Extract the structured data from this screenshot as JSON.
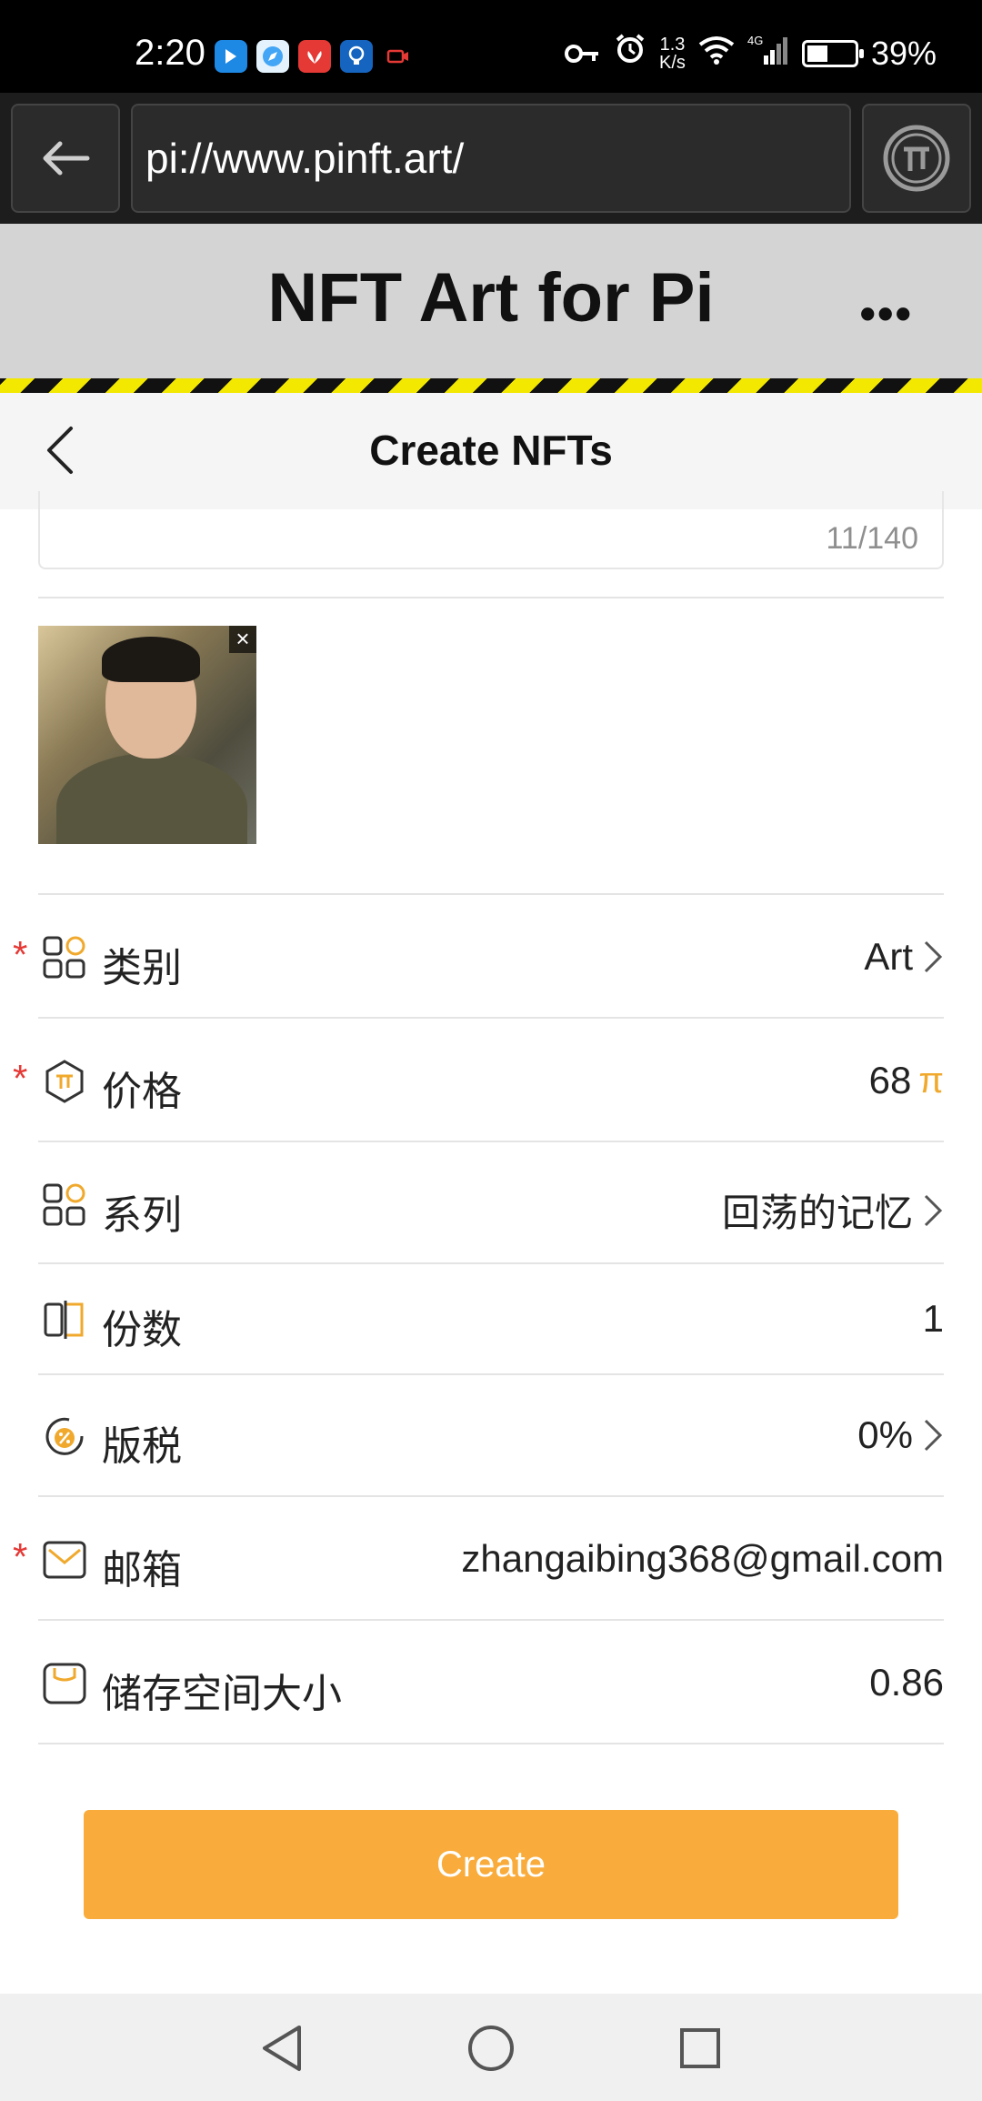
{
  "status_bar": {
    "time": "2:20",
    "net_speed": "1.3\nK/s",
    "network": "4G",
    "battery": "39%",
    "app_icons": [
      "bluetooth-app-icon",
      "safari-app-icon",
      "huawei-app-icon",
      "bulb-app-icon",
      "record-app-icon"
    ]
  },
  "browser": {
    "url": "pi://www.pinft.art/"
  },
  "app": {
    "title": "NFT Art for Pi",
    "menu": "•••"
  },
  "page": {
    "title": "Create NFTs"
  },
  "description": {
    "counter": "11/140"
  },
  "fields": [
    {
      "label": "类别",
      "value": "Art",
      "required": true,
      "chevron": true,
      "icon": "category-grid-icon"
    },
    {
      "label": "价格",
      "value": "68",
      "suffix": "π",
      "required": true,
      "chevron": false,
      "icon": "price-pi-icon"
    },
    {
      "label": "系列",
      "value": "回荡的记忆",
      "required": false,
      "chevron": true,
      "icon": "series-grid-icon"
    },
    {
      "label": "份数",
      "value": "1",
      "required": false,
      "chevron": false,
      "icon": "copies-icon"
    },
    {
      "label": "版税",
      "value": "0%",
      "required": false,
      "chevron": true,
      "icon": "royalty-percent-icon"
    },
    {
      "label": "邮箱",
      "value": "zhangaibing368@gmail.com",
      "required": true,
      "chevron": false,
      "icon": "email-icon"
    },
    {
      "label": "储存空间大小",
      "value": "0.86",
      "required": false,
      "chevron": false,
      "icon": "storage-icon"
    }
  ],
  "actions": {
    "create": "Create"
  },
  "colors": {
    "accent": "#f9ac3b",
    "required": "#e53935",
    "pi": "#f0a92c"
  }
}
